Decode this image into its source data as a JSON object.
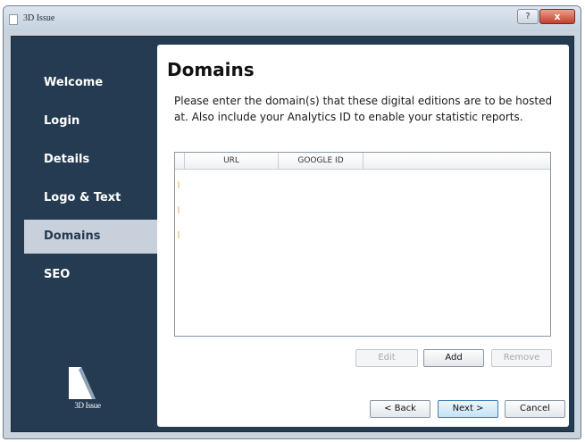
{
  "window": {
    "title": "3D Issue",
    "help_label": "?",
    "close_label": "x"
  },
  "sidebar": {
    "items": [
      {
        "label": "Welcome",
        "active": false
      },
      {
        "label": "Login",
        "active": false
      },
      {
        "label": "Details",
        "active": false
      },
      {
        "label": "Logo & Text",
        "active": false
      },
      {
        "label": "Domains",
        "active": true
      },
      {
        "label": "SEO",
        "active": false
      }
    ],
    "logo_text": "3D Issue"
  },
  "main": {
    "title": "Domains",
    "description": "Please enter the domain(s) that these digital editions are to be hosted at. Also include your Analytics ID to enable your statistic reports.",
    "table": {
      "columns": [
        "URL",
        "GOOGLE ID"
      ]
    },
    "actions": {
      "edit": "Edit",
      "add": "Add",
      "remove": "Remove"
    },
    "footer": {
      "back": "< Back",
      "next": "Next >",
      "cancel": "Cancel"
    }
  },
  "colors": {
    "sidebar_bg": "#253b52",
    "active_item_bg": "#c8d1db",
    "content_bg": "#ffffff"
  }
}
